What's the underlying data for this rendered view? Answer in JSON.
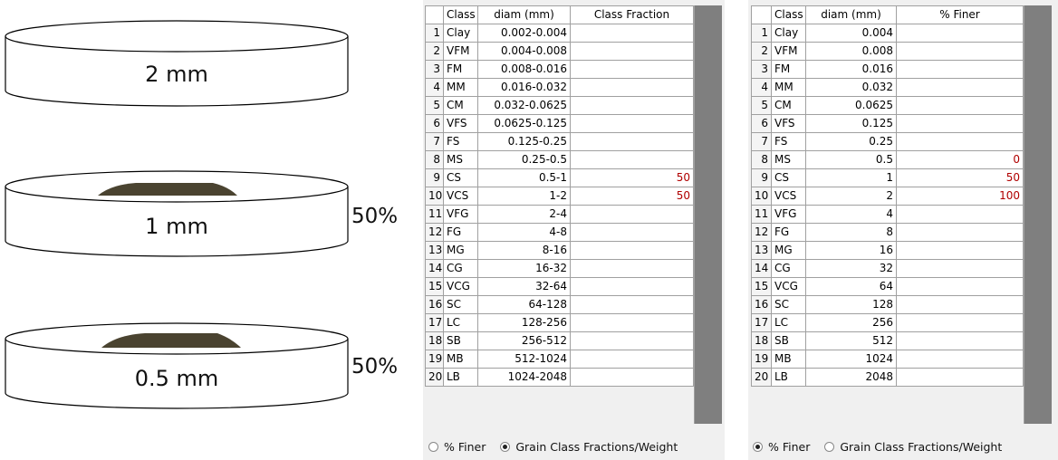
{
  "sieves": [
    {
      "label": "2 mm",
      "percent": "",
      "sediment": false
    },
    {
      "label": "1 mm",
      "percent": "50%",
      "sediment": true
    },
    {
      "label": "0.5 mm",
      "percent": "50%",
      "sediment": true
    }
  ],
  "left_table": {
    "headers": [
      "",
      "Class",
      "diam (mm)",
      "Class Fraction"
    ],
    "rows": [
      {
        "n": "1",
        "cls": "Clay",
        "diam": "0.002-0.004",
        "val": ""
      },
      {
        "n": "2",
        "cls": "VFM",
        "diam": "0.004-0.008",
        "val": ""
      },
      {
        "n": "3",
        "cls": "FM",
        "diam": "0.008-0.016",
        "val": ""
      },
      {
        "n": "4",
        "cls": "MM",
        "diam": "0.016-0.032",
        "val": ""
      },
      {
        "n": "5",
        "cls": "CM",
        "diam": "0.032-0.0625",
        "val": ""
      },
      {
        "n": "6",
        "cls": "VFS",
        "diam": "0.0625-0.125",
        "val": ""
      },
      {
        "n": "7",
        "cls": "FS",
        "diam": "0.125-0.25",
        "val": ""
      },
      {
        "n": "8",
        "cls": "MS",
        "diam": "0.25-0.5",
        "val": ""
      },
      {
        "n": "9",
        "cls": "CS",
        "diam": "0.5-1",
        "val": "50"
      },
      {
        "n": "10",
        "cls": "VCS",
        "diam": "1-2",
        "val": "50"
      },
      {
        "n": "11",
        "cls": "VFG",
        "diam": "2-4",
        "val": ""
      },
      {
        "n": "12",
        "cls": "FG",
        "diam": "4-8",
        "val": ""
      },
      {
        "n": "13",
        "cls": "MG",
        "diam": "8-16",
        "val": ""
      },
      {
        "n": "14",
        "cls": "CG",
        "diam": "16-32",
        "val": ""
      },
      {
        "n": "15",
        "cls": "VCG",
        "diam": "32-64",
        "val": ""
      },
      {
        "n": "16",
        "cls": "SC",
        "diam": "64-128",
        "val": ""
      },
      {
        "n": "17",
        "cls": "LC",
        "diam": "128-256",
        "val": ""
      },
      {
        "n": "18",
        "cls": "SB",
        "diam": "256-512",
        "val": ""
      },
      {
        "n": "19",
        "cls": "MB",
        "diam": "512-1024",
        "val": ""
      },
      {
        "n": "20",
        "cls": "LB",
        "diam": "1024-2048",
        "val": ""
      }
    ],
    "radio": {
      "opt1": "% Finer",
      "opt2": "Grain Class Fractions/Weight",
      "selected": "opt2"
    }
  },
  "right_table": {
    "headers": [
      "",
      "Class",
      "diam (mm)",
      "% Finer"
    ],
    "rows": [
      {
        "n": "1",
        "cls": "Clay",
        "diam": "0.004",
        "val": ""
      },
      {
        "n": "2",
        "cls": "VFM",
        "diam": "0.008",
        "val": ""
      },
      {
        "n": "3",
        "cls": "FM",
        "diam": "0.016",
        "val": ""
      },
      {
        "n": "4",
        "cls": "MM",
        "diam": "0.032",
        "val": ""
      },
      {
        "n": "5",
        "cls": "CM",
        "diam": "0.0625",
        "val": ""
      },
      {
        "n": "6",
        "cls": "VFS",
        "diam": "0.125",
        "val": ""
      },
      {
        "n": "7",
        "cls": "FS",
        "diam": "0.25",
        "val": ""
      },
      {
        "n": "8",
        "cls": "MS",
        "diam": "0.5",
        "val": "0"
      },
      {
        "n": "9",
        "cls": "CS",
        "diam": "1",
        "val": "50"
      },
      {
        "n": "10",
        "cls": "VCS",
        "diam": "2",
        "val": "100"
      },
      {
        "n": "11",
        "cls": "VFG",
        "diam": "4",
        "val": ""
      },
      {
        "n": "12",
        "cls": "FG",
        "diam": "8",
        "val": ""
      },
      {
        "n": "13",
        "cls": "MG",
        "diam": "16",
        "val": ""
      },
      {
        "n": "14",
        "cls": "CG",
        "diam": "32",
        "val": ""
      },
      {
        "n": "15",
        "cls": "VCG",
        "diam": "64",
        "val": ""
      },
      {
        "n": "16",
        "cls": "SC",
        "diam": "128",
        "val": ""
      },
      {
        "n": "17",
        "cls": "LC",
        "diam": "256",
        "val": ""
      },
      {
        "n": "18",
        "cls": "SB",
        "diam": "512",
        "val": ""
      },
      {
        "n": "19",
        "cls": "MB",
        "diam": "1024",
        "val": ""
      },
      {
        "n": "20",
        "cls": "LB",
        "diam": "2048",
        "val": ""
      }
    ],
    "radio": {
      "opt1": "% Finer",
      "opt2": "Grain Class Fractions/Weight",
      "selected": "opt1"
    }
  },
  "colors": {
    "sediment": "#4a4330",
    "value_text": "#b00000",
    "scrollbar": "#7f7f7f"
  }
}
